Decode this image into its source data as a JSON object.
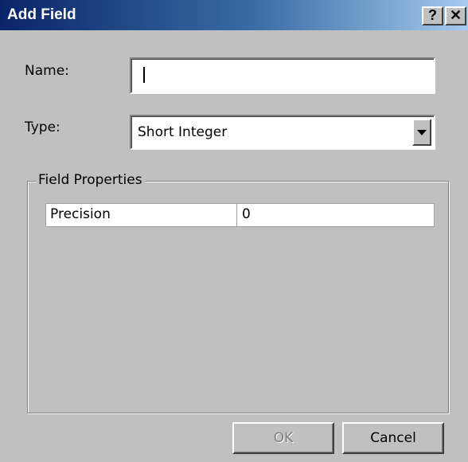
{
  "window": {
    "title": "Add Field",
    "help_label": "?",
    "close_label": "✕"
  },
  "form": {
    "name_label": "Name:",
    "name_value": "",
    "type_label": "Type:",
    "type_value": "Short Integer"
  },
  "field_properties": {
    "title": "Field Properties",
    "rows": [
      {
        "name": "Precision",
        "value": "0"
      }
    ]
  },
  "buttons": {
    "ok_label": "OK",
    "ok_enabled": false,
    "cancel_label": "Cancel"
  },
  "colors": {
    "title_bar_start": "#0a246a",
    "title_bar_end": "#a6caf0",
    "dialog_bg": "#c0c0c0"
  }
}
